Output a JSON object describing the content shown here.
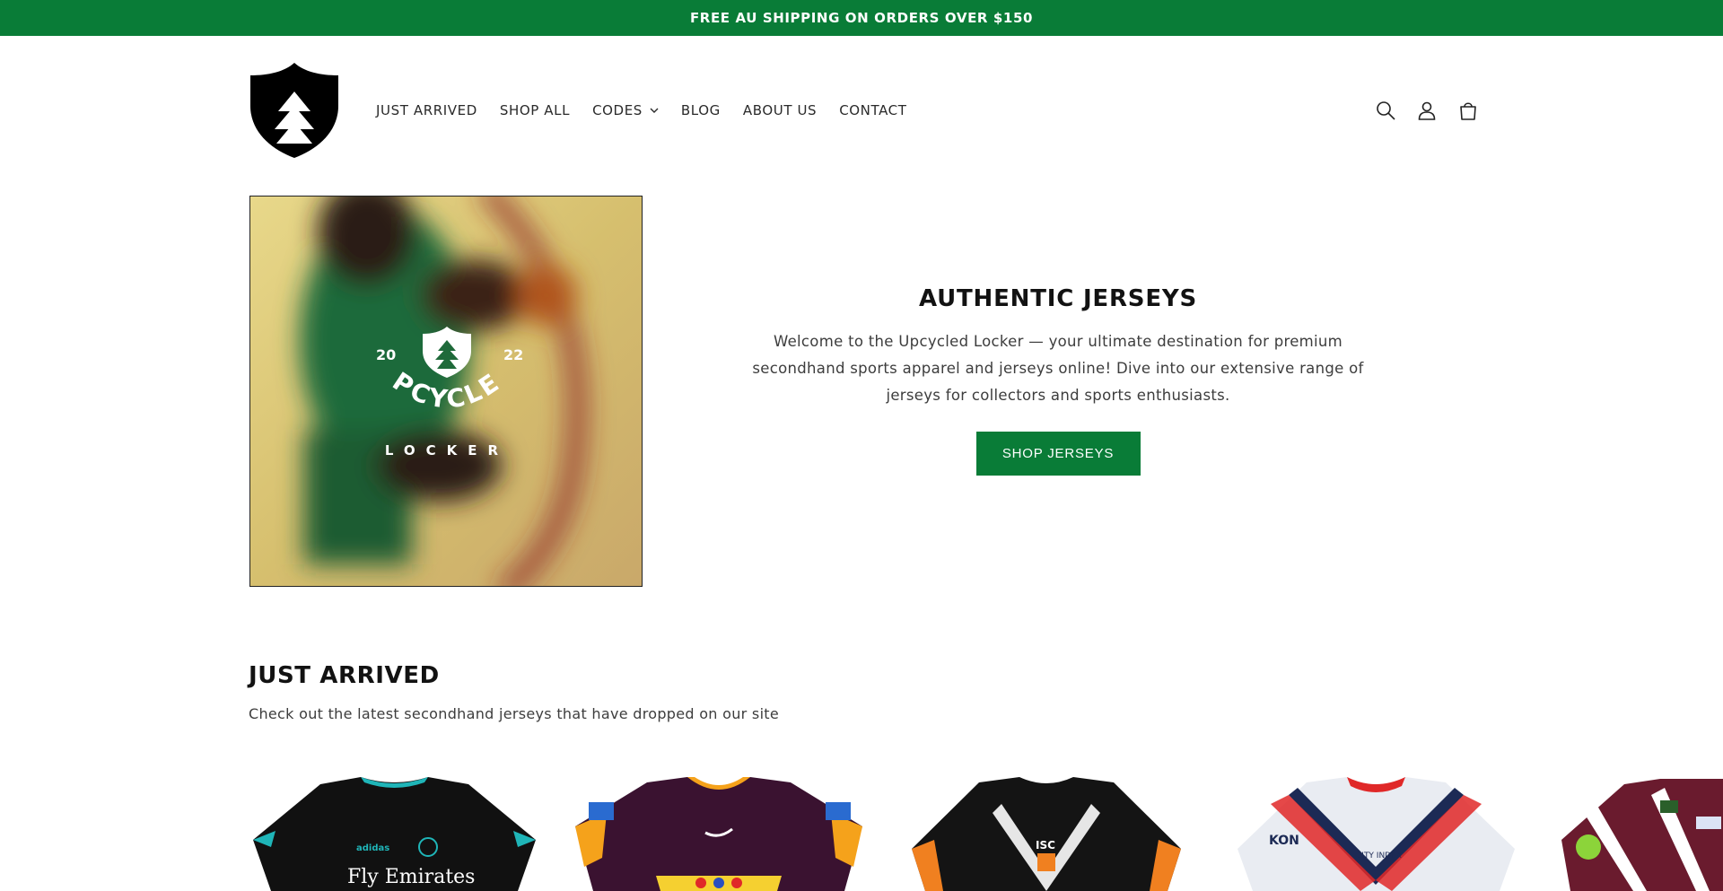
{
  "announcement": {
    "text": "FREE AU SHIPPING ON ORDERS OVER $150"
  },
  "header": {
    "logo_icon": "shield-tree-logo",
    "nav": [
      {
        "label": "JUST ARRIVED"
      },
      {
        "label": "SHOP ALL"
      },
      {
        "label": "CODES",
        "has_dropdown": true
      },
      {
        "label": "BLOG"
      },
      {
        "label": "ABOUT US"
      },
      {
        "label": "CONTACT"
      }
    ],
    "icons": [
      "search-icon",
      "account-icon",
      "cart-icon"
    ]
  },
  "hero": {
    "image_logo": {
      "year_left": "20",
      "year_right": "22",
      "word1": "UPCYCLED",
      "word2": "LOCKER"
    },
    "title": "AUTHENTIC JERSEYS",
    "description": "Welcome to the Upcycled Locker — your ultimate destination for premium secondhand sports apparel and jerseys online! Dive into our extensive range of jerseys for collectors and sports enthusiasts.",
    "button": "SHOP JERSEYS"
  },
  "just_arrived": {
    "title": "JUST ARRIVED",
    "subtitle": "Check out the latest secondhand jerseys that have dropped on our site",
    "products": [
      {
        "kind": "real-madrid-away-jersey",
        "sponsor": "Fly Emirates",
        "colors": [
          "#111111",
          "#1fb5b8"
        ]
      },
      {
        "kind": "brisbane-broncos-jersey",
        "colors": [
          "#3a1230",
          "#f5a21b"
        ]
      },
      {
        "kind": "wests-tigers-jersey",
        "colors": [
          "#141414",
          "#f08020"
        ]
      },
      {
        "kind": "sydney-roosters-jersey",
        "colors": [
          "#e9ecf2",
          "#1c2a55"
        ]
      },
      {
        "kind": "manly-sea-eagles-jersey",
        "colors": [
          "#6a1b2e",
          "#ffffff"
        ]
      }
    ]
  },
  "colors": {
    "brand_green": "#097c37",
    "text": "#121212"
  }
}
